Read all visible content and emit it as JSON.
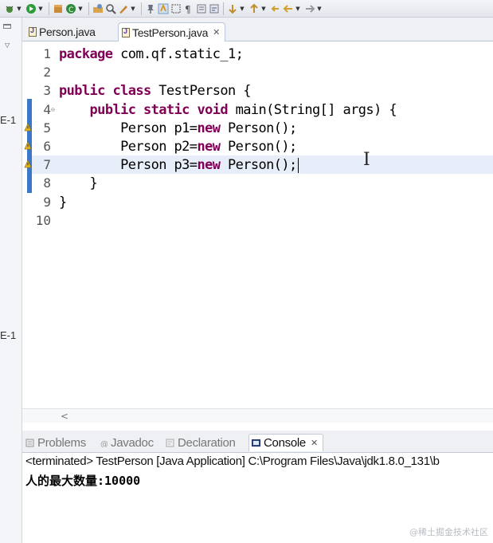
{
  "editor": {
    "tabs": [
      {
        "label": "Person.java",
        "active": false
      },
      {
        "label": "TestPerson.java",
        "active": true
      }
    ],
    "lines": [
      {
        "num": "1",
        "tokens": [
          {
            "t": "package",
            "kw": true
          },
          {
            "t": " com.qf.static_1;"
          }
        ]
      },
      {
        "num": "2",
        "tokens": []
      },
      {
        "num": "3",
        "tokens": [
          {
            "t": "public",
            "kw": true
          },
          {
            "t": " "
          },
          {
            "t": "class",
            "kw": true
          },
          {
            "t": " TestPerson {"
          }
        ]
      },
      {
        "num": "4",
        "fold": true,
        "tokens": [
          {
            "t": "    "
          },
          {
            "t": "public",
            "kw": true
          },
          {
            "t": " "
          },
          {
            "t": "static",
            "kw": true
          },
          {
            "t": " "
          },
          {
            "t": "void",
            "kw": true
          },
          {
            "t": " main(String[] args) {"
          }
        ]
      },
      {
        "num": "5",
        "warn": true,
        "tokens": [
          {
            "t": "        Person p1="
          },
          {
            "t": "new",
            "kw": true
          },
          {
            "t": " Person();"
          }
        ]
      },
      {
        "num": "6",
        "warn": true,
        "tokens": [
          {
            "t": "        Person p2="
          },
          {
            "t": "new",
            "kw": true
          },
          {
            "t": " Person();"
          }
        ]
      },
      {
        "num": "7",
        "warn": true,
        "current": true,
        "tokens": [
          {
            "t": "        Person p3="
          },
          {
            "t": "new",
            "kw": true
          },
          {
            "t": " Person();"
          }
        ]
      },
      {
        "num": "8",
        "tokens": [
          {
            "t": "    }"
          }
        ]
      },
      {
        "num": "9",
        "tokens": [
          {
            "t": "}"
          }
        ]
      },
      {
        "num": "10",
        "tokens": []
      }
    ]
  },
  "left_pane": {
    "labels": [
      "E-1",
      "E-1"
    ]
  },
  "bottom_panel": {
    "tabs": [
      {
        "label": "Problems",
        "active": false
      },
      {
        "label": "Javadoc",
        "active": false
      },
      {
        "label": "Declaration",
        "active": false
      },
      {
        "label": "Console",
        "active": true
      }
    ],
    "console_header": "<terminated> TestPerson [Java Application] C:\\Program Files\\Java\\jdk1.8.0_131\\b",
    "console_output": "人的最大数量:10000"
  },
  "scroll_arrow": "<",
  "watermark": "@稀土掘金技术社区",
  "colors": {
    "keyword": "#7f0055",
    "current_line": "#e8eef9",
    "ruler_mark": "#3b78c7"
  }
}
